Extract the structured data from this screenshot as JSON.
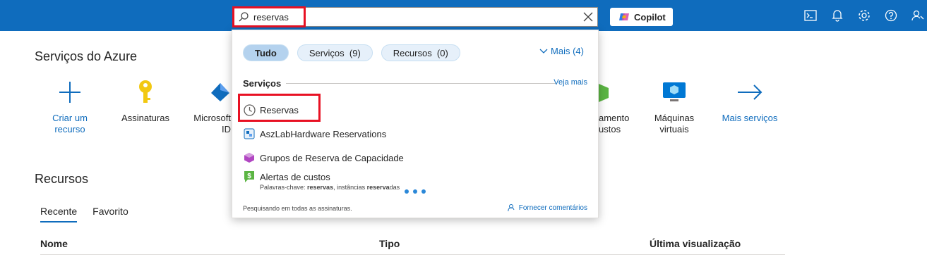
{
  "topbar": {
    "search_value": "reservas",
    "copilot_label": "Copilot",
    "icons": [
      "cloud-shell-icon",
      "bell-icon",
      "gear-icon",
      "help-icon",
      "feedback-icon"
    ]
  },
  "main": {
    "services_title": "Serviços do Azure",
    "services": [
      {
        "label": "Criar um recurso",
        "icon": "plus-icon"
      },
      {
        "label": "Assinaturas",
        "icon": "key-icon"
      },
      {
        "label": "Microsoft Entra ID",
        "icon": "entra-icon"
      },
      {
        "label": "Gerenciamento de Custos",
        "icon": "cost-icon"
      },
      {
        "label": "Máquinas virtuais",
        "icon": "vm-icon"
      },
      {
        "label": "Mais serviços",
        "icon": "arrow-right-icon"
      }
    ],
    "visible_labels": {
      "create_line1": "Criar um",
      "create_line2": "recurso",
      "subscriptions": "Assinaturas",
      "entra_line1": "Microsoft",
      "entra_line2": "ID",
      "cost_line1": "amento",
      "cost_line2": "ustos",
      "vm_line1": "Máquinas",
      "vm_line2": "virtuais",
      "more_services": "Mais serviços"
    },
    "resources_title": "Recursos",
    "tabs": [
      "Recente",
      "Favorito"
    ],
    "columns": [
      "Nome",
      "Tipo",
      "Última visualização"
    ]
  },
  "dropdown": {
    "filters": [
      {
        "label": "Tudo",
        "active": true
      },
      {
        "label": "Serviços  (9)",
        "active": false
      },
      {
        "label": "Recursos  (0)",
        "active": false
      }
    ],
    "more_label": "Mais (4)",
    "section_heading": "Serviços",
    "see_more": "Veja mais",
    "items": [
      {
        "label": "Reservas",
        "icon": "clock-icon"
      },
      {
        "label": "AszLabHardware Reservations",
        "icon": "lab-hardware-icon"
      },
      {
        "label": "Grupos de Reserva de Capacidade",
        "icon": "cube-icon"
      },
      {
        "label": "Alertas de custos",
        "icon": "cost-alert-icon"
      }
    ],
    "keywords_prefix": "Palavras-chave: ",
    "keywords_bold1": "reservas",
    "keywords_mid": ", instâncias ",
    "keywords_bold2": "reserva",
    "keywords_tail": "das",
    "footer_left": "Pesquisando em todas as assinaturas.",
    "footer_right": "Fornecer comentários"
  }
}
